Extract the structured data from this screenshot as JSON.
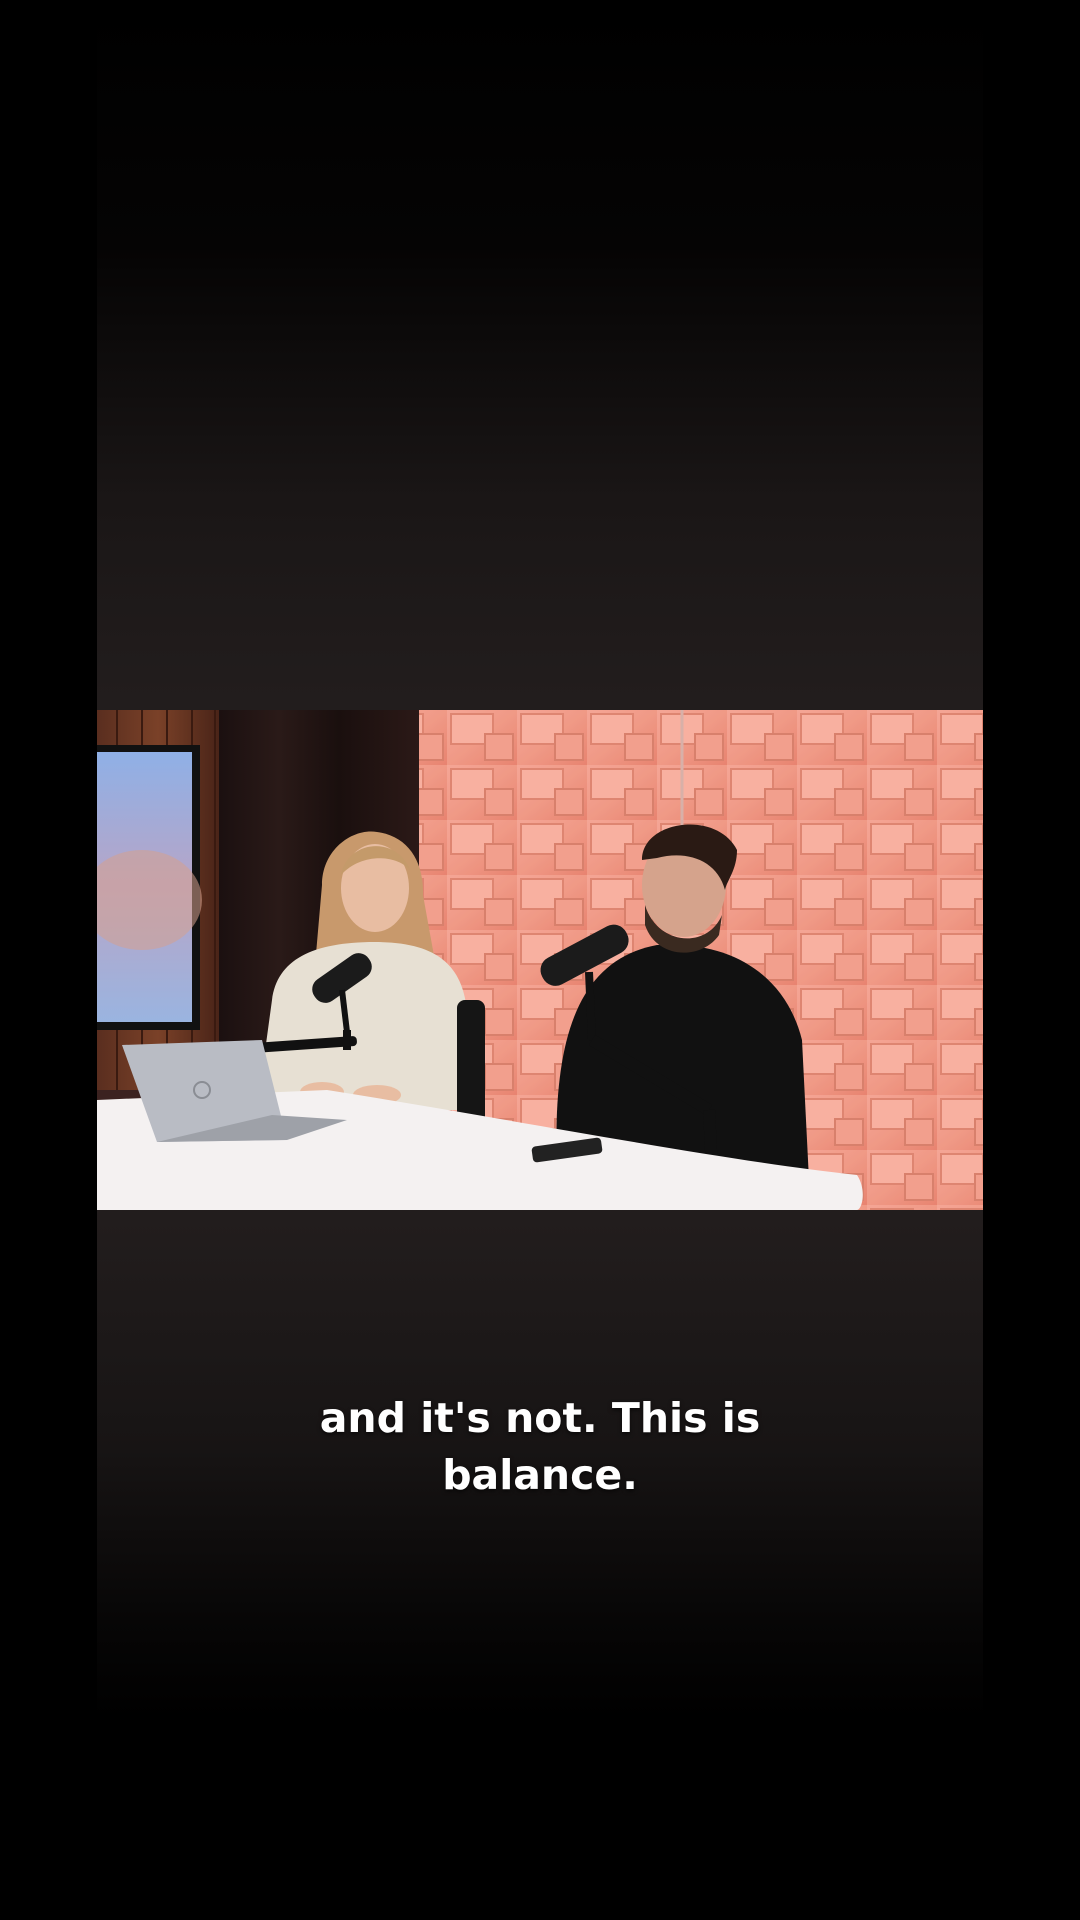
{
  "video": {
    "subtitle_lines": [
      "and it's not. This is",
      "balance."
    ]
  },
  "colors": {
    "background": "#000000",
    "wall_panel": "#f0a292",
    "table": "#f4f1f1",
    "subtitle": "#ffffff"
  }
}
